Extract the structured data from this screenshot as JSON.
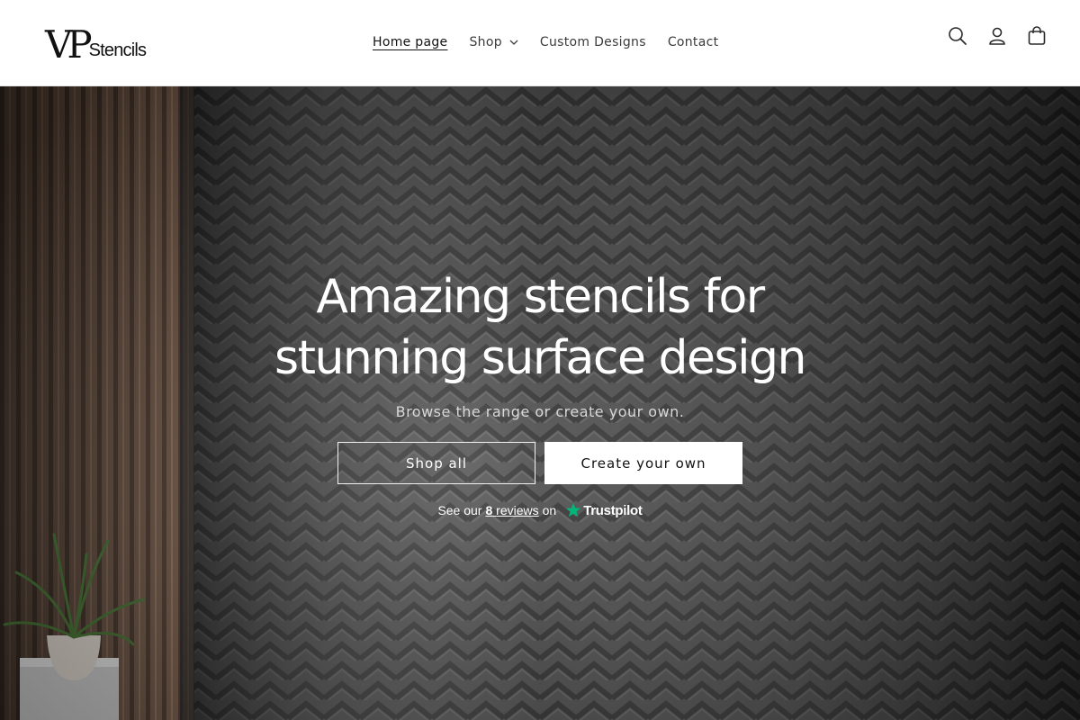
{
  "header": {
    "logo": {
      "mark": "VP",
      "text": "Stencils"
    },
    "nav": [
      {
        "label": "Home page",
        "active": true
      },
      {
        "label": "Shop",
        "has_dropdown": true
      },
      {
        "label": "Custom Designs"
      },
      {
        "label": "Contact"
      }
    ],
    "icons": [
      "search-icon",
      "account-icon",
      "cart-icon"
    ]
  },
  "hero": {
    "title": "Amazing stencils for stunning surface design",
    "subtitle": "Browse the range or create your own.",
    "buttons": {
      "primary": "Shop all",
      "secondary": "Create your own"
    },
    "trustpilot": {
      "prefix": "See our",
      "count": "8",
      "reviews_label": "reviews",
      "suffix": "on",
      "brand": "Trustpilot",
      "star_color": "#00b67a"
    }
  },
  "colors": {
    "header_bg": "#ffffff",
    "text_dark": "#121212",
    "hero_text": "#ffffff"
  }
}
